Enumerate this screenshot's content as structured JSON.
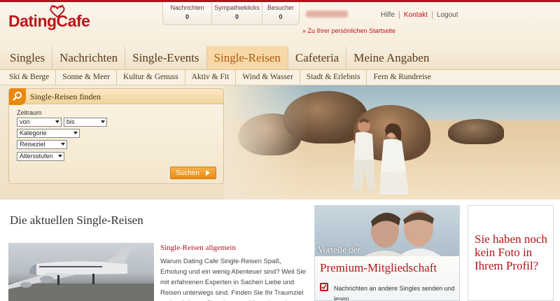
{
  "brand": {
    "name": "DatingCafe",
    "accent": "#c0141c",
    "orange": "#ea8b14"
  },
  "stats": [
    {
      "label": "Nachrichten",
      "value": "0"
    },
    {
      "label": "Sympathieklicks",
      "value": "0"
    },
    {
      "label": "Besucher",
      "value": "0"
    }
  ],
  "toplinks": {
    "help": "Hilfe",
    "contact": "Kontakt",
    "logout": "Logout"
  },
  "startpage_link": "» Zu Ihrer persönlichen Startseite",
  "mainnav": [
    "Singles",
    "Nachrichten",
    "Single-Events",
    "Single-Reisen",
    "Cafeteria",
    "Meine Angaben"
  ],
  "mainnav_active": "Single-Reisen",
  "subnav": [
    "Ski & Berge",
    "Sonne & Meer",
    "Kultur & Genuss",
    "Aktiv & Fit",
    "Wind & Wasser",
    "Stadt & Erlebnis",
    "Fern & Rundreise"
  ],
  "search": {
    "title": "Single-Reisen finden",
    "period_label": "Zeitraum",
    "from": "von",
    "to": "bis",
    "category": "Kategorie",
    "destination": "Reiseziel",
    "age": "Altersstufen",
    "submit": "Suchen"
  },
  "content": {
    "title": "Die aktuellen Single-Reisen",
    "article_title": "Single-Reisen allgemein",
    "article_text": "Warum Dating Cafe Single-Reisen Spaß, Erholung und ein wenig Abenteuer sind? Weil Sie mit erfahrenen Experten in Sachen Liebe und Reisen unterwegs sind. Finden Sie Ihr Traumziel und verbringen Sie mit netten Menschen eine tolle Zeit"
  },
  "premium": {
    "pretitle": "Vorteile der",
    "title": "Premium-Mitgliedschaft",
    "benefit": "Nachrichten an andere Singles senden und lesen"
  },
  "photo_prompt": "Sie haben noch kein Foto in Ihrem Profil?"
}
